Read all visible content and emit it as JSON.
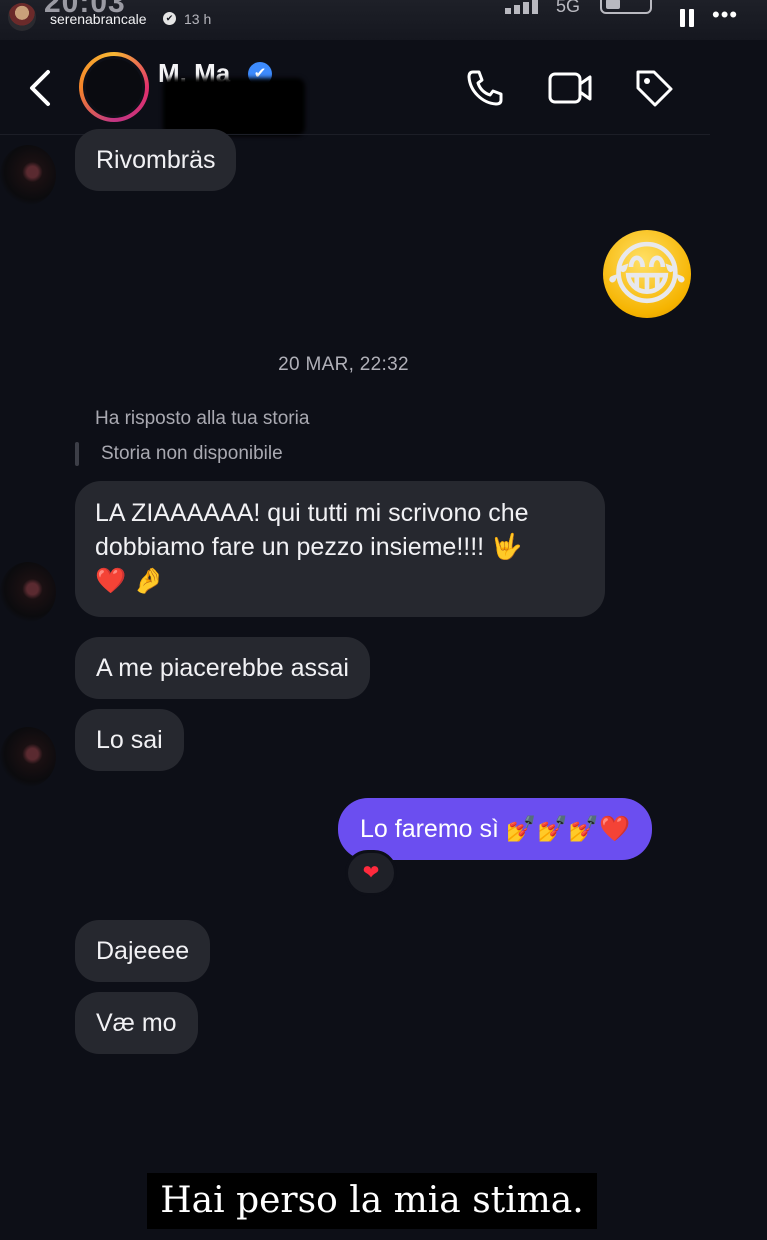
{
  "story": {
    "clock": "20:03",
    "username": "serenabrancale",
    "verified_mark": "✔",
    "posted_ago": "13 h",
    "network": "5G",
    "more_glyph": "•••"
  },
  "chat_header": {
    "contact_name": "M. Ma",
    "verified_mark": "✔",
    "icons": [
      "back-chevron-icon",
      "phone-icon",
      "video-camera-icon",
      "tag-icon"
    ]
  },
  "messages": {
    "m1": "Rivombräs",
    "emoji_reply": "😂",
    "timestamp": "20 MAR, 22:32",
    "reply_label": "Ha risposto alla tua storia",
    "reply_story": "Storia non disponibile",
    "m2_line1": "LA ZIAAAAAA! qui tutti mi scrivono che",
    "m2_line2": "dobbiamo fare un pezzo insieme!!!! 🤟",
    "m2_line3": "❤️ 🤌",
    "m3": "A me piacerebbe assai",
    "m4": "Lo sai",
    "m5": "Lo faremo sì 💅💅💅❤️",
    "m5_reaction": "❤",
    "m6": "Dajeeee",
    "m7": "Væ mo"
  },
  "caption": "Hai perso la mia stima.",
  "colors": {
    "background": "#0d0f17",
    "incoming_bubble": "#26282f",
    "outgoing_bubble": "#6b4ef0",
    "verified_blue": "#3d8bfd"
  }
}
